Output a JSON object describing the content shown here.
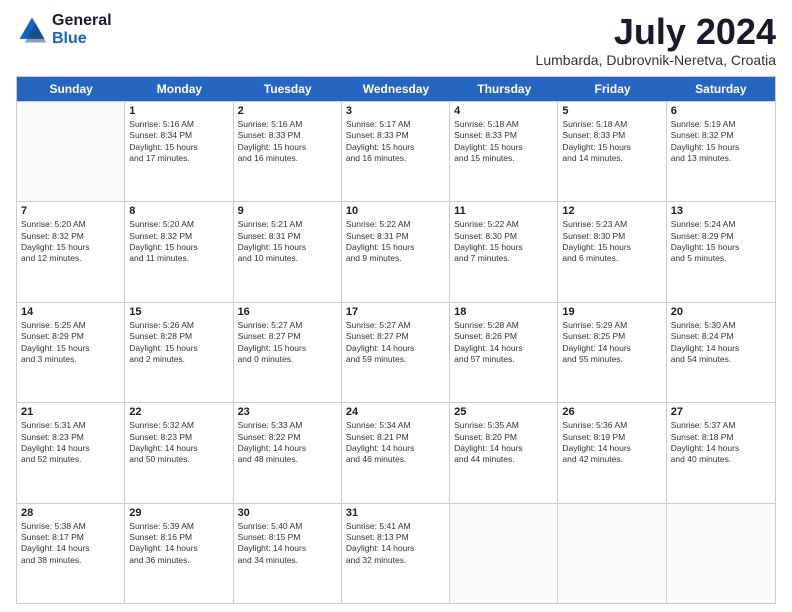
{
  "logo": {
    "general": "General",
    "blue": "Blue"
  },
  "title": "July 2024",
  "location": "Lumbarda, Dubrovnik-Neretva, Croatia",
  "weekdays": [
    "Sunday",
    "Monday",
    "Tuesday",
    "Wednesday",
    "Thursday",
    "Friday",
    "Saturday"
  ],
  "weeks": [
    [
      {
        "day": "",
        "info": ""
      },
      {
        "day": "1",
        "info": "Sunrise: 5:16 AM\nSunset: 8:34 PM\nDaylight: 15 hours\nand 17 minutes."
      },
      {
        "day": "2",
        "info": "Sunrise: 5:16 AM\nSunset: 8:33 PM\nDaylight: 15 hours\nand 16 minutes."
      },
      {
        "day": "3",
        "info": "Sunrise: 5:17 AM\nSunset: 8:33 PM\nDaylight: 15 hours\nand 16 minutes."
      },
      {
        "day": "4",
        "info": "Sunrise: 5:18 AM\nSunset: 8:33 PM\nDaylight: 15 hours\nand 15 minutes."
      },
      {
        "day": "5",
        "info": "Sunrise: 5:18 AM\nSunset: 8:33 PM\nDaylight: 15 hours\nand 14 minutes."
      },
      {
        "day": "6",
        "info": "Sunrise: 5:19 AM\nSunset: 8:32 PM\nDaylight: 15 hours\nand 13 minutes."
      }
    ],
    [
      {
        "day": "7",
        "info": "Sunrise: 5:20 AM\nSunset: 8:32 PM\nDaylight: 15 hours\nand 12 minutes."
      },
      {
        "day": "8",
        "info": "Sunrise: 5:20 AM\nSunset: 8:32 PM\nDaylight: 15 hours\nand 11 minutes."
      },
      {
        "day": "9",
        "info": "Sunrise: 5:21 AM\nSunset: 8:31 PM\nDaylight: 15 hours\nand 10 minutes."
      },
      {
        "day": "10",
        "info": "Sunrise: 5:22 AM\nSunset: 8:31 PM\nDaylight: 15 hours\nand 9 minutes."
      },
      {
        "day": "11",
        "info": "Sunrise: 5:22 AM\nSunset: 8:30 PM\nDaylight: 15 hours\nand 7 minutes."
      },
      {
        "day": "12",
        "info": "Sunrise: 5:23 AM\nSunset: 8:30 PM\nDaylight: 15 hours\nand 6 minutes."
      },
      {
        "day": "13",
        "info": "Sunrise: 5:24 AM\nSunset: 8:29 PM\nDaylight: 15 hours\nand 5 minutes."
      }
    ],
    [
      {
        "day": "14",
        "info": "Sunrise: 5:25 AM\nSunset: 8:29 PM\nDaylight: 15 hours\nand 3 minutes."
      },
      {
        "day": "15",
        "info": "Sunrise: 5:26 AM\nSunset: 8:28 PM\nDaylight: 15 hours\nand 2 minutes."
      },
      {
        "day": "16",
        "info": "Sunrise: 5:27 AM\nSunset: 8:27 PM\nDaylight: 15 hours\nand 0 minutes."
      },
      {
        "day": "17",
        "info": "Sunrise: 5:27 AM\nSunset: 8:27 PM\nDaylight: 14 hours\nand 59 minutes."
      },
      {
        "day": "18",
        "info": "Sunrise: 5:28 AM\nSunset: 8:26 PM\nDaylight: 14 hours\nand 57 minutes."
      },
      {
        "day": "19",
        "info": "Sunrise: 5:29 AM\nSunset: 8:25 PM\nDaylight: 14 hours\nand 55 minutes."
      },
      {
        "day": "20",
        "info": "Sunrise: 5:30 AM\nSunset: 8:24 PM\nDaylight: 14 hours\nand 54 minutes."
      }
    ],
    [
      {
        "day": "21",
        "info": "Sunrise: 5:31 AM\nSunset: 8:23 PM\nDaylight: 14 hours\nand 52 minutes."
      },
      {
        "day": "22",
        "info": "Sunrise: 5:32 AM\nSunset: 8:23 PM\nDaylight: 14 hours\nand 50 minutes."
      },
      {
        "day": "23",
        "info": "Sunrise: 5:33 AM\nSunset: 8:22 PM\nDaylight: 14 hours\nand 48 minutes."
      },
      {
        "day": "24",
        "info": "Sunrise: 5:34 AM\nSunset: 8:21 PM\nDaylight: 14 hours\nand 46 minutes."
      },
      {
        "day": "25",
        "info": "Sunrise: 5:35 AM\nSunset: 8:20 PM\nDaylight: 14 hours\nand 44 minutes."
      },
      {
        "day": "26",
        "info": "Sunrise: 5:36 AM\nSunset: 8:19 PM\nDaylight: 14 hours\nand 42 minutes."
      },
      {
        "day": "27",
        "info": "Sunrise: 5:37 AM\nSunset: 8:18 PM\nDaylight: 14 hours\nand 40 minutes."
      }
    ],
    [
      {
        "day": "28",
        "info": "Sunrise: 5:38 AM\nSunset: 8:17 PM\nDaylight: 14 hours\nand 38 minutes."
      },
      {
        "day": "29",
        "info": "Sunrise: 5:39 AM\nSunset: 8:16 PM\nDaylight: 14 hours\nand 36 minutes."
      },
      {
        "day": "30",
        "info": "Sunrise: 5:40 AM\nSunset: 8:15 PM\nDaylight: 14 hours\nand 34 minutes."
      },
      {
        "day": "31",
        "info": "Sunrise: 5:41 AM\nSunset: 8:13 PM\nDaylight: 14 hours\nand 32 minutes."
      },
      {
        "day": "",
        "info": ""
      },
      {
        "day": "",
        "info": ""
      },
      {
        "day": "",
        "info": ""
      }
    ]
  ]
}
